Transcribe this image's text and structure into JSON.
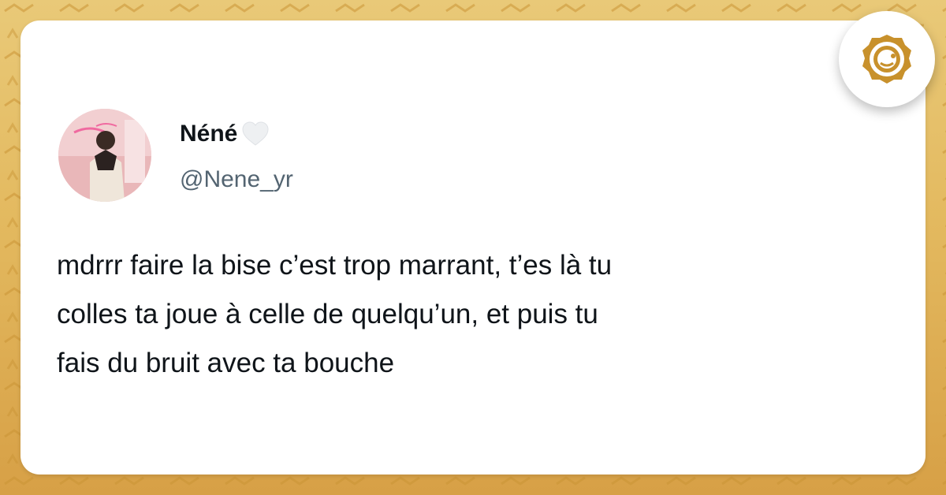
{
  "tweet": {
    "display_name": "Néné",
    "name_emoji": "white-heart-icon",
    "handle": "@Nene_yr",
    "text_lines": [
      "mdrrr faire la bise c’est trop marrant, t’es là tu",
      "colles ta joue à celle de quelqu’un, et puis tu",
      "fais du bruit avec ta bouche"
    ]
  },
  "brand": {
    "logo": "brand-logo-icon"
  },
  "colors": {
    "background": "#e3b95f",
    "card": "#ffffff",
    "text": "#0f1419",
    "handle": "#536471",
    "logo": "#c8912c"
  }
}
